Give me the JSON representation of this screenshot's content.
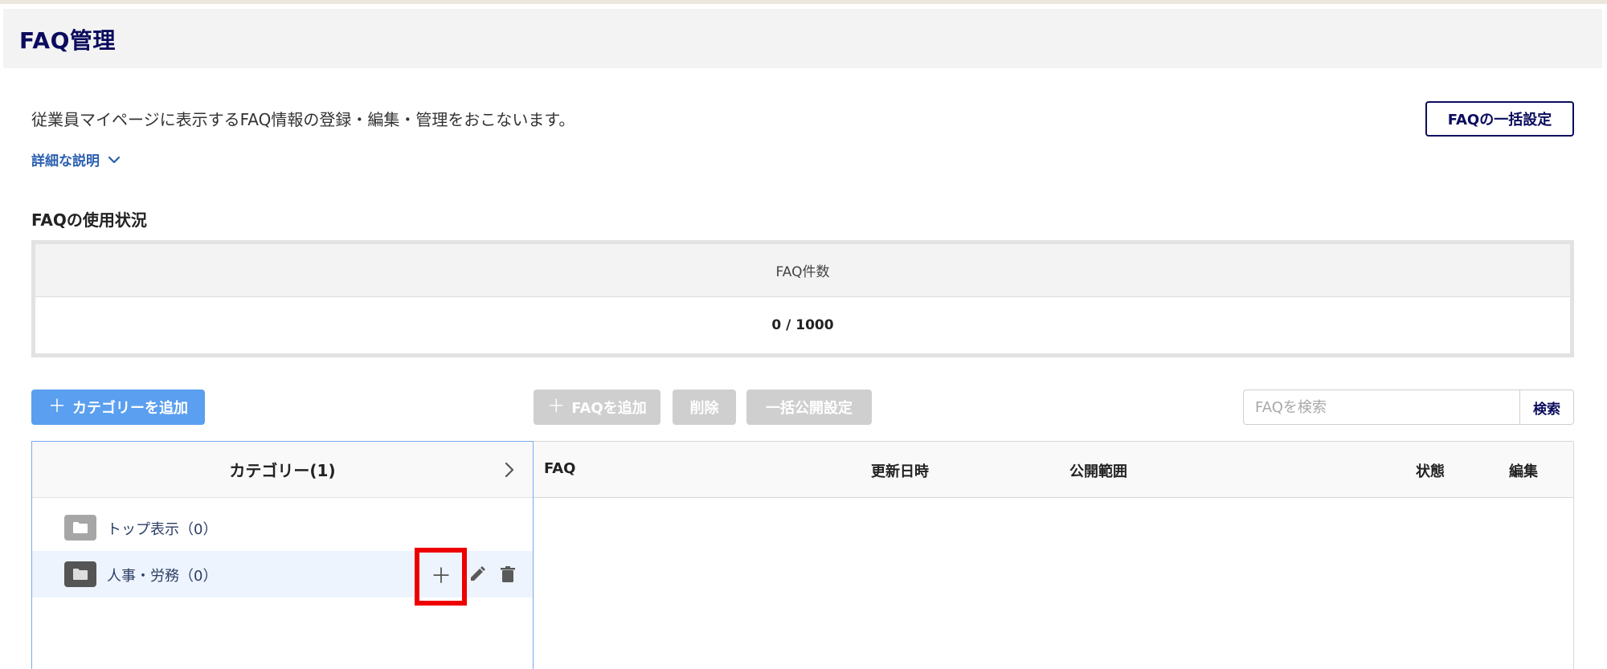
{
  "page": {
    "title": "FAQ管理",
    "description": "従業員マイページに表示するFAQ情報の登録・編集・管理をおこないます。",
    "details_link": "詳細な説明",
    "bulk_settings_button": "FAQの一括設定"
  },
  "usage": {
    "heading": "FAQの使用状況",
    "column_label": "FAQ件数",
    "value": "0 / 1000"
  },
  "toolbar": {
    "add_category": "カテゴリーを追加",
    "add_faq": "FAQを追加",
    "delete": "削除",
    "bulk_publish": "一括公開設定",
    "search_placeholder": "FAQを検索",
    "search_button": "検索"
  },
  "categories": {
    "header": "カテゴリー(1)",
    "items": [
      {
        "label": "トップ表示（0）",
        "icon": "folder-icon",
        "active": false
      },
      {
        "label": "人事・労務（0）",
        "icon": "folder-icon",
        "active": true
      }
    ]
  },
  "faq_table": {
    "columns": [
      "FAQ",
      "更新日時",
      "公開範囲",
      "状態",
      "編集"
    ]
  },
  "colors": {
    "brand_navy": "#0b0b5e",
    "primary_blue": "#5a9ff0",
    "disabled_gray": "#cfcfcf",
    "link_blue": "#2b5fb0",
    "highlight_red": "#ee0000"
  }
}
